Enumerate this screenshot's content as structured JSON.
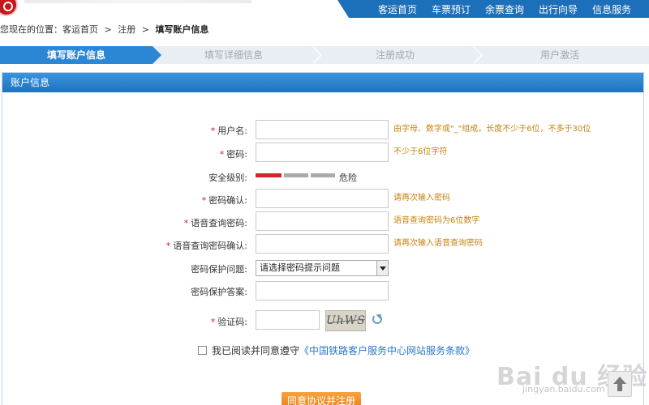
{
  "topnav": {
    "items": [
      "客运首页",
      "车票预订",
      "余票查询",
      "出行向导",
      "信息服务"
    ]
  },
  "breadcrumb": {
    "prefix": "您现在的位置：客运首页",
    "sep": ">",
    "middle": "注册",
    "current": "填写账户信息"
  },
  "steps": {
    "items": [
      "填写账户信息",
      "填写详细信息",
      "注册成功",
      "用户激活"
    ]
  },
  "panel": {
    "title": "账户信息"
  },
  "form": {
    "required_mark": "*",
    "username": {
      "label": "用户名:",
      "hint": "由字母、数字或\"_\"组成，长度不少于6位，不多于30位"
    },
    "password": {
      "label": "密码:",
      "hint": "不少于6位字符"
    },
    "security": {
      "label": "安全级别:",
      "level_text": "危险",
      "level_fraction": 0.33
    },
    "password_confirm": {
      "label": "密码确认:",
      "hint": "请再次输入密码"
    },
    "voice_pwd": {
      "label": "语音查询密码:",
      "hint": "语音查询密码为6位数字"
    },
    "voice_pwd_confirm": {
      "label": "语音查询密码确认:",
      "hint": "请再次输入语音查询密码"
    },
    "pwd_question": {
      "label": "密码保护问题:",
      "selected": "请选择密码提示问题"
    },
    "pwd_answer": {
      "label": "密码保护答案:"
    },
    "captcha": {
      "label": "验证码:",
      "image_text": "UhWS"
    },
    "agreement": {
      "prefix": "我已阅读并同意遵守",
      "link": "《中国铁路客户服务中心网站服务条款》"
    },
    "submit_label": "同意协议并注册"
  },
  "watermark": {
    "main": "Bai du 经验",
    "sub": "jingyan.baidu.com"
  },
  "colors": {
    "brand_blue": "#1c6fb9",
    "hint_orange": "#c7820e",
    "required_red": "#d02020",
    "danger_red": "#d42424",
    "button_orange": "#e57d12"
  }
}
